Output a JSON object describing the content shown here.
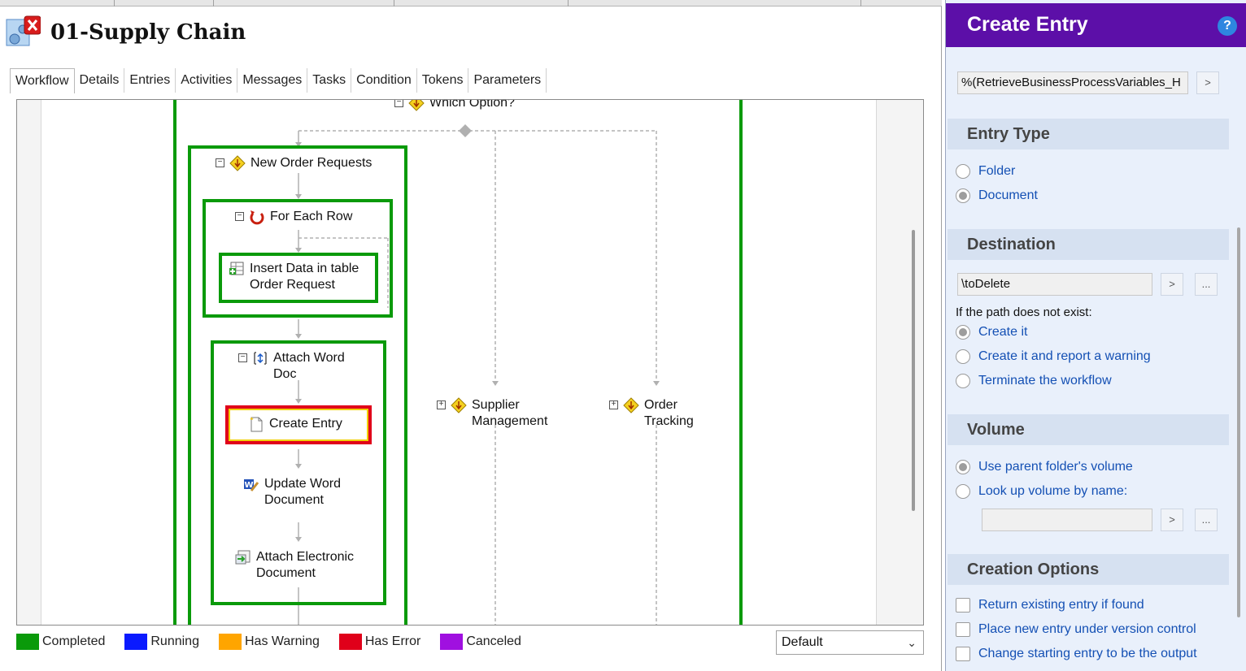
{
  "workflow": {
    "title": "01-Supply Chain",
    "tabs": [
      "Workflow",
      "Details",
      "Entries",
      "Activities",
      "Messages",
      "Tasks",
      "Condition",
      "Tokens",
      "Parameters"
    ],
    "nodes": {
      "which_option": "Which Option?",
      "new_order_requests": "New Order Requests",
      "for_each_row": "For Each Row",
      "insert_data": "Insert Data in table\nOrder Request",
      "attach_word_doc": "Attach Word\nDoc",
      "create_entry": "Create Entry",
      "update_word": "Update Word\nDocument",
      "attach_electronic": "Attach Electronic\nDocument",
      "supplier_management": "Supplier\nManagement",
      "order_tracking": "Order\nTracking"
    },
    "legend": [
      {
        "label": "Completed",
        "color": "#0a9a0a"
      },
      {
        "label": "Running",
        "color": "#0a1aff"
      },
      {
        "label": "Has Warning",
        "color": "#ffa500"
      },
      {
        "label": "Has Error",
        "color": "#e0001a"
      },
      {
        "label": "Canceled",
        "color": "#a010e0"
      }
    ],
    "view_select": "Default"
  },
  "panel": {
    "title": "Create Entry",
    "entry_name_value": "%(RetrieveBusinessProcessVariables_H",
    "entry_type": {
      "heading": "Entry Type",
      "options": [
        "Folder",
        "Document"
      ],
      "selected": 1
    },
    "destination": {
      "heading": "Destination",
      "value": "\\toDelete",
      "if_not_exist_label": "If the path does not exist:",
      "options": [
        "Create it",
        "Create it and report a warning",
        "Terminate the workflow"
      ],
      "selected": 0
    },
    "volume": {
      "heading": "Volume",
      "options": [
        "Use parent folder's volume",
        "Look up volume by name:"
      ],
      "selected": 0,
      "volume_value": ""
    },
    "creation_options": {
      "heading": "Creation Options",
      "checks": [
        "Return existing entry if found",
        "Place new entry under version control",
        "Change starting entry to be the output"
      ]
    },
    "button_arrow": ">",
    "button_browse": "..."
  }
}
